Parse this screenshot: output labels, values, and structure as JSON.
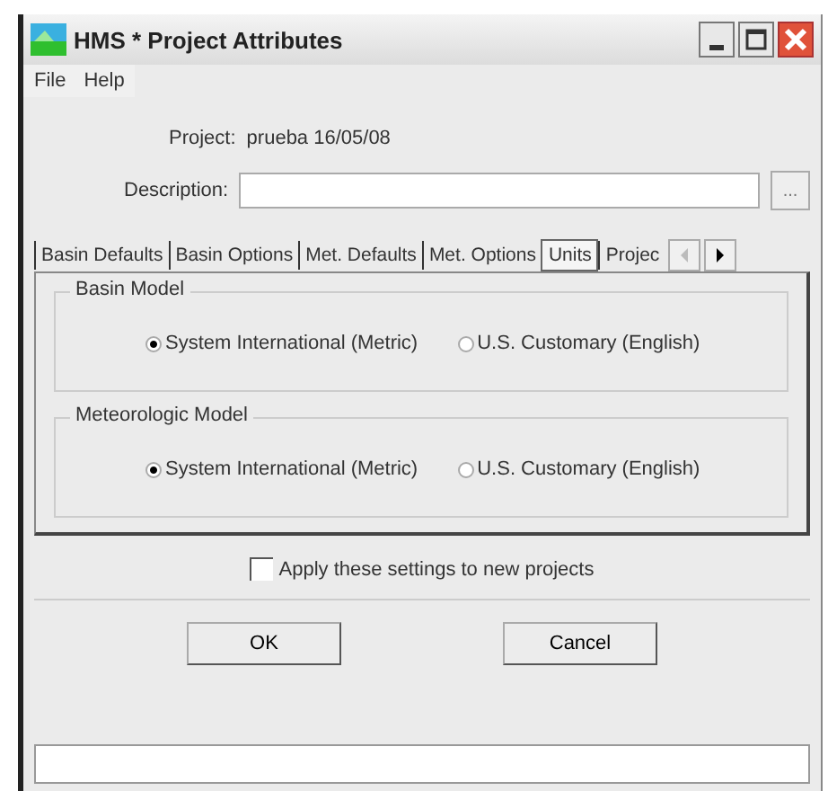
{
  "window": {
    "title": "HMS * Project Attributes"
  },
  "menu": [
    "File",
    "Help"
  ],
  "project": {
    "label": "Project:",
    "value": "prueba 16/05/08"
  },
  "description": {
    "label": "Description:",
    "button": "..."
  },
  "tabs": [
    {
      "label": "Basin Defaults",
      "selected": false
    },
    {
      "label": "Basin Options",
      "selected": false
    },
    {
      "label": "Met. Defaults",
      "selected": false
    },
    {
      "label": "Met. Options",
      "selected": false
    },
    {
      "label": "Units",
      "selected": true
    },
    {
      "label": "Projec",
      "selected": false
    }
  ],
  "groups": [
    {
      "title": "Basin Model",
      "options": [
        {
          "label": "System International (Metric)",
          "selected": true
        },
        {
          "label": "U.S. Customary (English)",
          "selected": false
        }
      ]
    },
    {
      "title": "Meteorologic Model",
      "options": [
        {
          "label": "System International (Metric)",
          "selected": true
        },
        {
          "label": "U.S. Customary (English)",
          "selected": false
        }
      ]
    }
  ],
  "apply": {
    "label": "Apply these settings to new projects",
    "checked": false
  },
  "buttons": [
    "OK",
    "Cancel"
  ]
}
